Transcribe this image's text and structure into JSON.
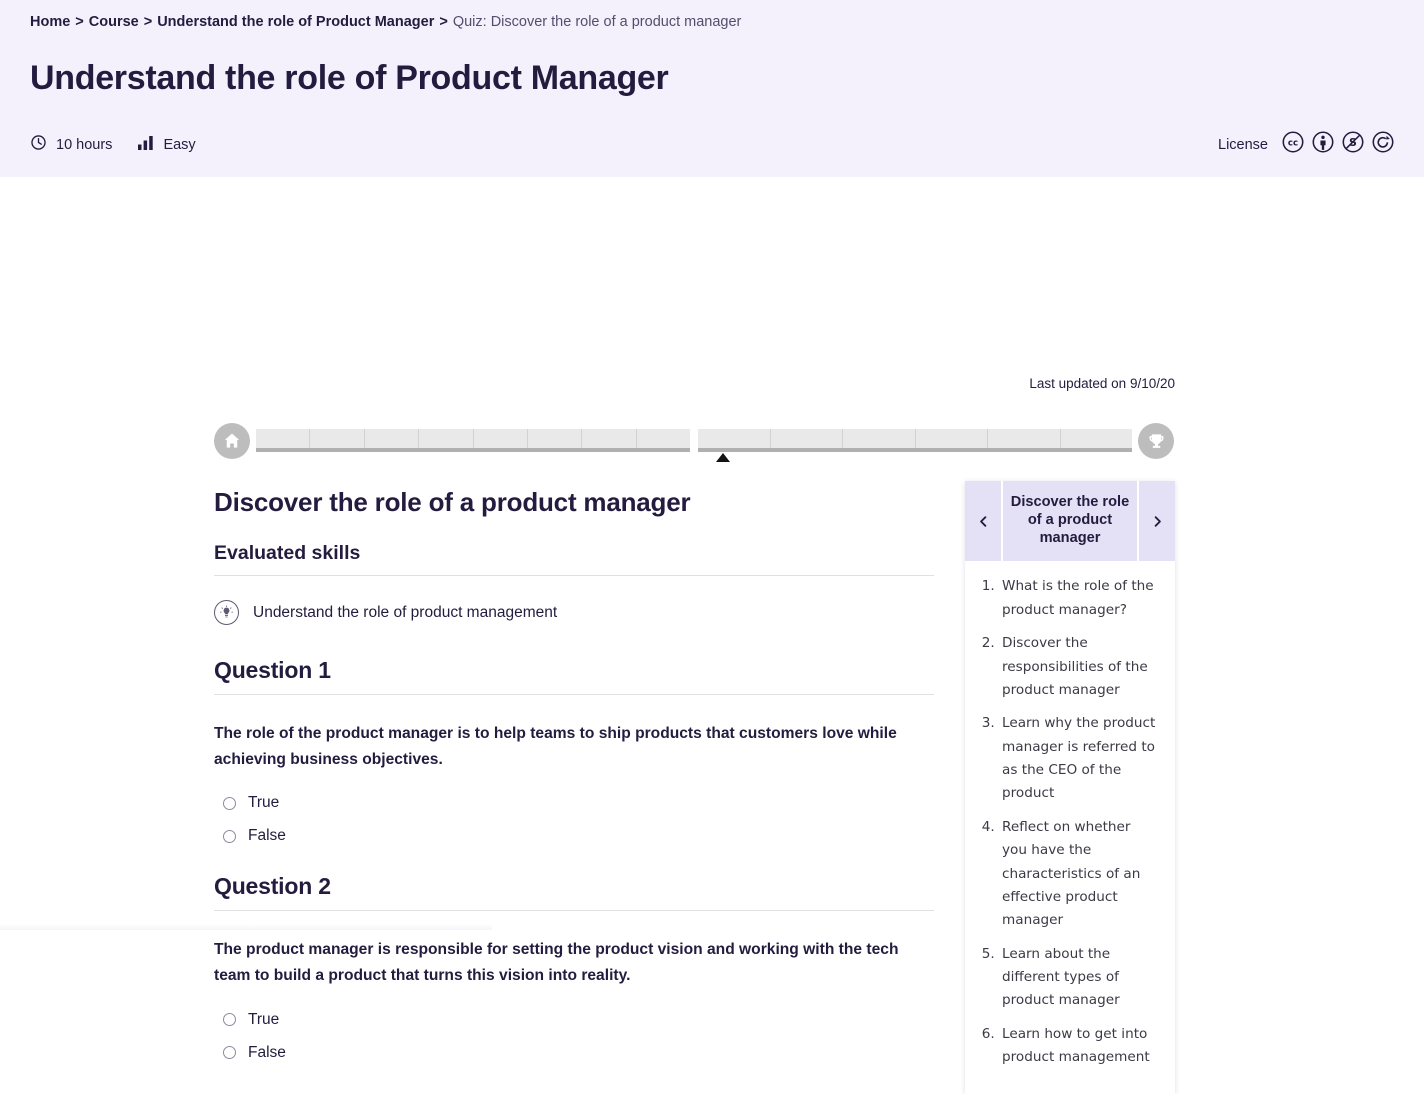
{
  "breadcrumb": {
    "items": [
      {
        "label": "Home",
        "current": false
      },
      {
        "label": "Course",
        "current": false
      },
      {
        "label": "Understand the role of Product Manager",
        "current": false
      },
      {
        "label": "Quiz: Discover the role of a product manager",
        "current": true
      }
    ],
    "separator": ">"
  },
  "header": {
    "title": "Understand the role of Product Manager",
    "duration": "10 hours",
    "difficulty": "Easy",
    "license_label": "License",
    "license_icons": [
      "cc-icon",
      "cc-by-icon",
      "cc-nc-icon",
      "cc-sa-icon"
    ],
    "background_color": "#f4f1fd",
    "text_color": "#241c3f"
  },
  "last_updated": "Last updated on 9/10/20",
  "progress": {
    "start_icon": "home-icon",
    "end_icon": "trophy-icon",
    "total_segments": 14,
    "group_one_segments": 8,
    "group_two_segments": 6,
    "current_marker_segment": 8,
    "track_color": "#e9e9e9",
    "endpoint_color": "#bdbdbd"
  },
  "main": {
    "section_title": "Discover the role of a product manager",
    "skills_heading": "Evaluated skills",
    "skills": [
      {
        "icon": "lightbulb-icon",
        "label": "Understand the role of product management"
      }
    ],
    "questions": [
      {
        "title": "Question 1",
        "prompt": "The role of the product manager is to help teams to ship products that customers love while achieving business objectives.",
        "options": [
          {
            "label": "True",
            "selected": false
          },
          {
            "label": "False",
            "selected": false
          }
        ]
      },
      {
        "title": "Question 2",
        "prompt": "The product manager is responsible for setting the product vision and working with the tech team to build a product that turns this vision into reality.",
        "options": [
          {
            "label": "True",
            "selected": false
          },
          {
            "label": "False",
            "selected": false
          }
        ]
      }
    ]
  },
  "side_panel": {
    "title": "Discover the role of a product manager",
    "prev_icon": "chevron-left-icon",
    "next_icon": "chevron-right-icon",
    "prev_label": "‹",
    "next_label": "›",
    "header_color": "#e4e0f6",
    "items": [
      "What is the role of the product manager?",
      "Discover the responsibilities of the product manager",
      "Learn why the product manager is referred to as the CEO of the product",
      "Reflect on whether you have the characteristics of an effective product manager",
      "Learn about the different types of product manager",
      "Learn how to get into product management"
    ]
  }
}
